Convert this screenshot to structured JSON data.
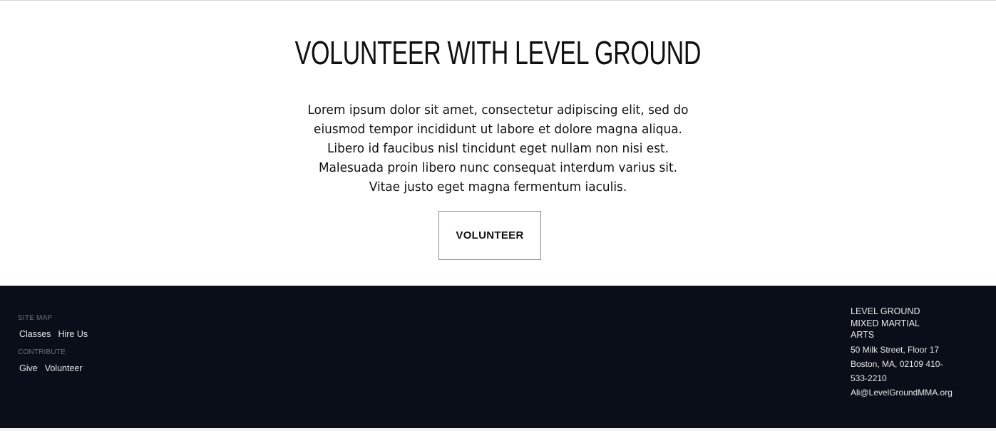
{
  "hero": {
    "title": "VOLUNTEER WITH LEVEL GROUND",
    "body_lines": [
      "Lorem ipsum dolor sit amet, consectetur adipiscing elit, sed do",
      "eiusmod tempor incididunt ut labore et dolore magna aliqua.",
      "Libero id faucibus nisl tincidunt eget nullam non nisi est.",
      "Malesuada proin libero nunc consequat interdum varius sit.",
      "Vitae justo eget magna fermentum iaculis."
    ],
    "button_label": "VOLUNTEER"
  },
  "footer": {
    "site_map": {
      "label": "SITE MAP",
      "links": [
        "Classes",
        "Hire Us"
      ]
    },
    "contribute": {
      "label": "CONTRIBUTE",
      "links": [
        "Give",
        "Volunteer"
      ]
    },
    "contact": {
      "org_name": "LEVEL GROUND MIXED MARTIAL ARTS",
      "address_line_1": "50 Milk Street, Floor 17",
      "address_line_2": "Boston, MA, 02109 410-",
      "phone_tail": "533-2210",
      "email": "Ali@LevelGroundMMA.org"
    }
  },
  "colors": {
    "footer_bg": "#0a0e18",
    "footer_text": "#e8e9ec",
    "footer_label": "#6a6f7a",
    "hero_text": "#111111"
  }
}
